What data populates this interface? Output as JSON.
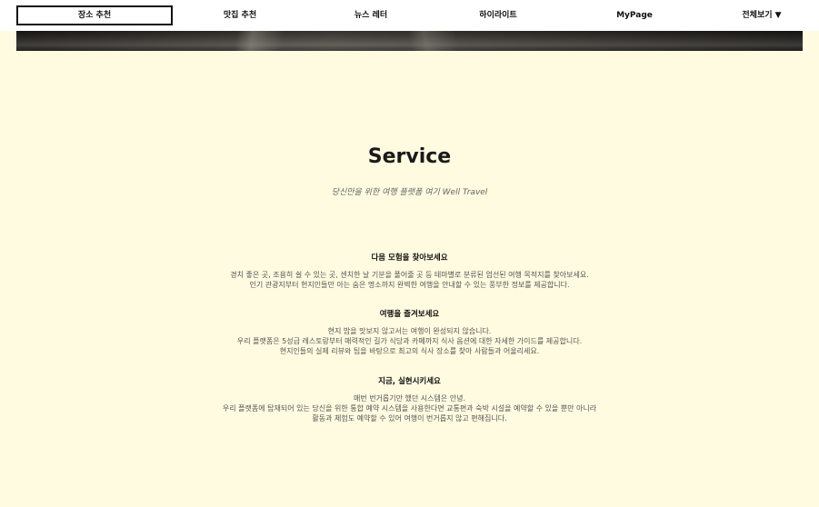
{
  "nav": {
    "items": [
      {
        "label": "장소 추천"
      },
      {
        "label": "맛집 추천"
      },
      {
        "label": "뉴스 레터"
      },
      {
        "label": "하이라이트"
      },
      {
        "label": "MyPage"
      },
      {
        "label": "전체보기 ▼"
      }
    ]
  },
  "hero": {
    "title": "Service",
    "subtitle": "당신만을 위한 여행 플랫폼 여기 Well Travel"
  },
  "sections": [
    {
      "heading": "다음 모험을 찾아보세요",
      "lines": [
        "경치 좋은 곳, 조용히 쉴 수 있는 곳, 센치한 날 기분을 풀어줄 곳 등 테마별로 분류된 엄선된 여행 목적지를 찾아보세요.",
        "인기 관광지부터 현지인들만 아는 숨은 명소까지 완벽한 여행을 안내할 수 있는 풍부한 정보를 제공합니다."
      ]
    },
    {
      "heading": "여행을 즐겨보세요",
      "lines": [
        "현지 밥을 맛보지 않고서는 여행이 완성되지 않습니다.",
        "우리 플랫폼은 5성급 레스토랑부터 매력적인 길가 식당과 카페까지 식사 옵션에 대한 자세한 가이드를 제공합니다.",
        "현지인들의 실제 리뷰와 팁을 바탕으로 최고의 식사 장소를 찾아 사람들과 어울리세요."
      ]
    },
    {
      "heading": "지금, 실현시키세요",
      "lines": [
        "매번 번거롭기만 했던 시스템은 안녕.",
        "우리 플랫폼에 탑재되어 있는 당신을 위한 통합 예약 시스템을 사용한다면 교통편과 숙박 시설을 예약할 수 있을 뿐만 아니라",
        "활동과 체험도 예약할 수 있어 여행이 번거롭지 않고 편해집니다."
      ]
    }
  ]
}
